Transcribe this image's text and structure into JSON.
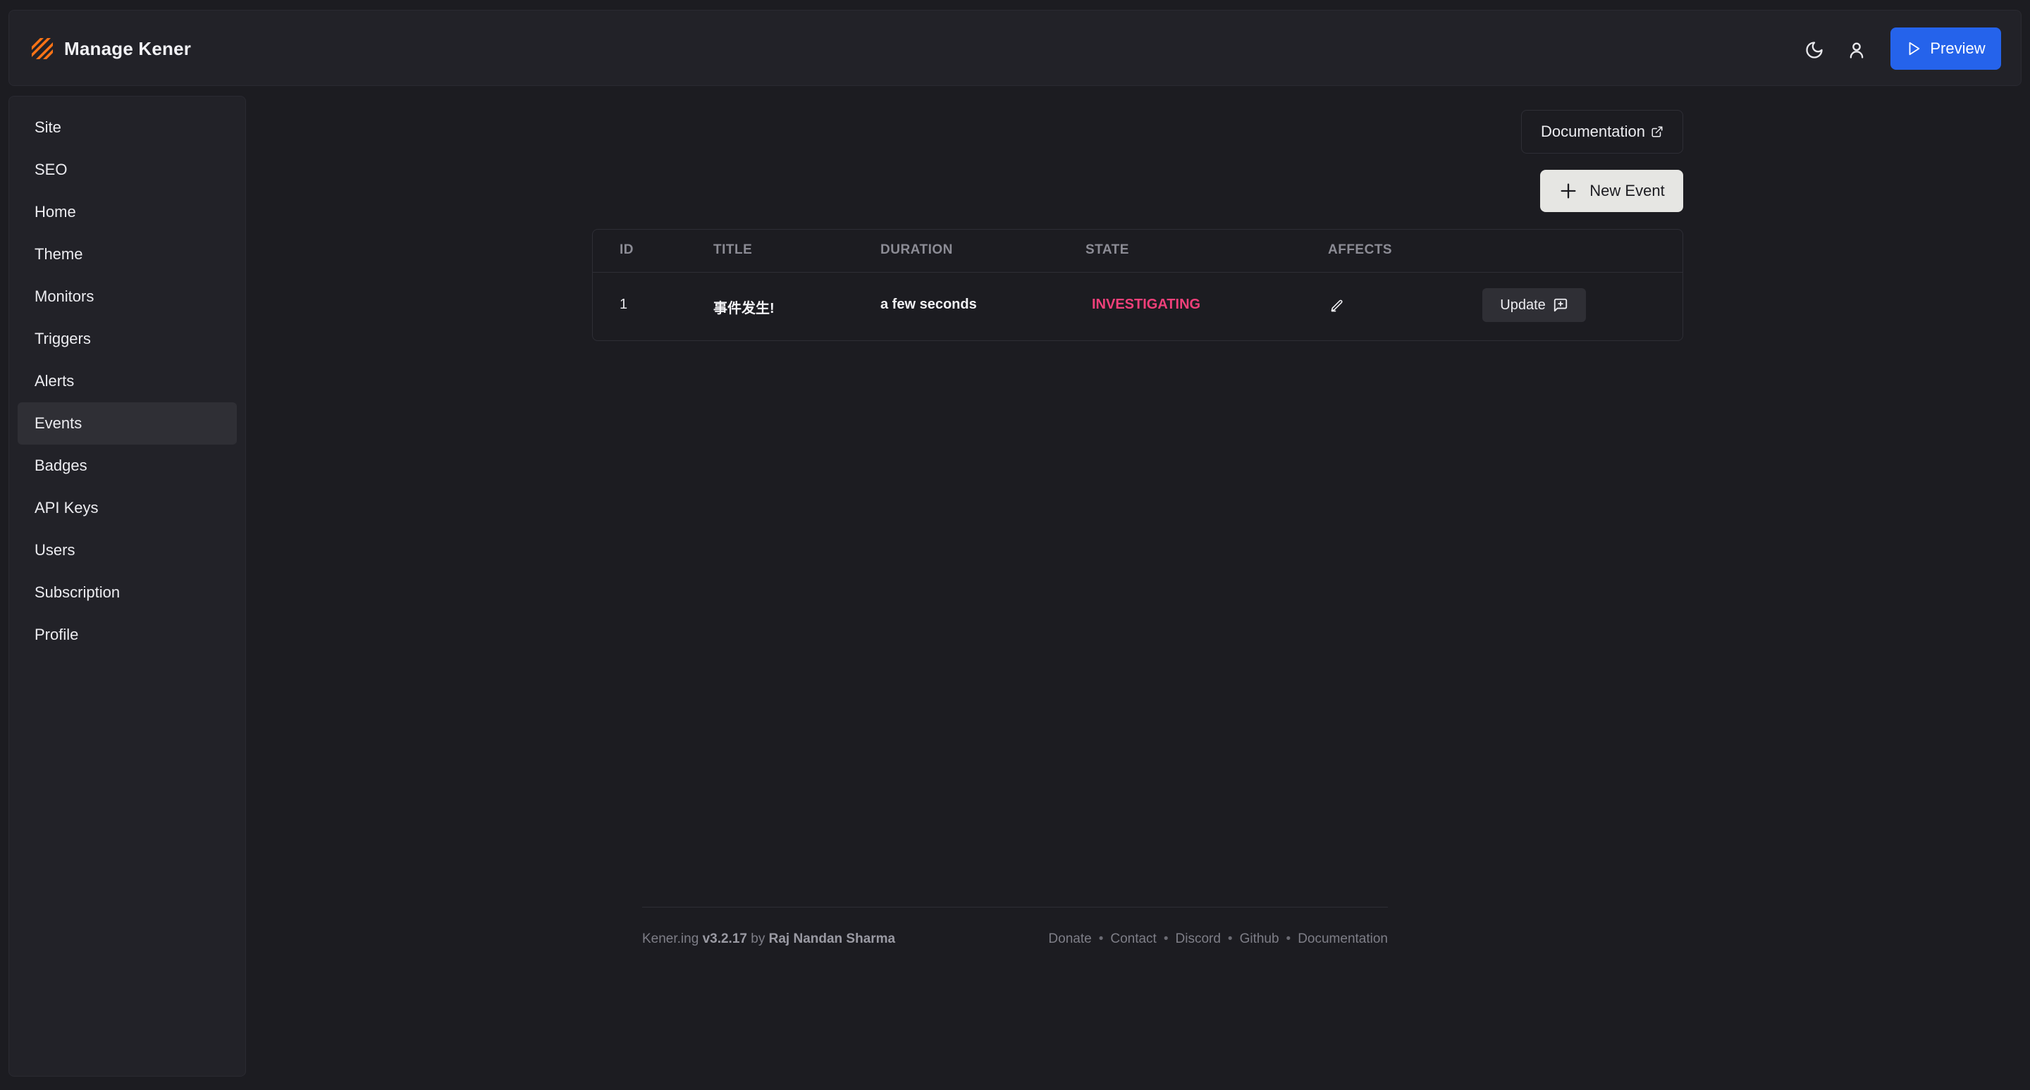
{
  "header": {
    "title": "Manage Kener",
    "preview_label": "Preview"
  },
  "sidebar": {
    "items": [
      {
        "label": "Site"
      },
      {
        "label": "SEO"
      },
      {
        "label": "Home"
      },
      {
        "label": "Theme"
      },
      {
        "label": "Monitors"
      },
      {
        "label": "Triggers"
      },
      {
        "label": "Alerts"
      },
      {
        "label": "Events",
        "active": true
      },
      {
        "label": "Badges"
      },
      {
        "label": "API Keys"
      },
      {
        "label": "Users"
      },
      {
        "label": "Subscription"
      },
      {
        "label": "Profile"
      }
    ]
  },
  "main": {
    "documentation_label": "Documentation",
    "new_event_label": "New Event",
    "table": {
      "columns": [
        "ID",
        "TITLE",
        "DURATION",
        "STATE",
        "AFFECTS"
      ],
      "rows": [
        {
          "id": "1",
          "title": "事件发生!",
          "duration": "a few seconds",
          "state": "INVESTIGATING",
          "action_label": "Update"
        }
      ]
    }
  },
  "footer": {
    "brand": "Kener.ing",
    "version": "v3.2.17",
    "by": "by",
    "author": "Raj Nandan Sharma",
    "links": [
      "Donate",
      "Contact",
      "Discord",
      "Github",
      "Documentation"
    ]
  },
  "colors": {
    "background": "#1c1c21",
    "accent": "#2563eb",
    "state_investigating": "#f0407a",
    "logo": "#f97316"
  }
}
